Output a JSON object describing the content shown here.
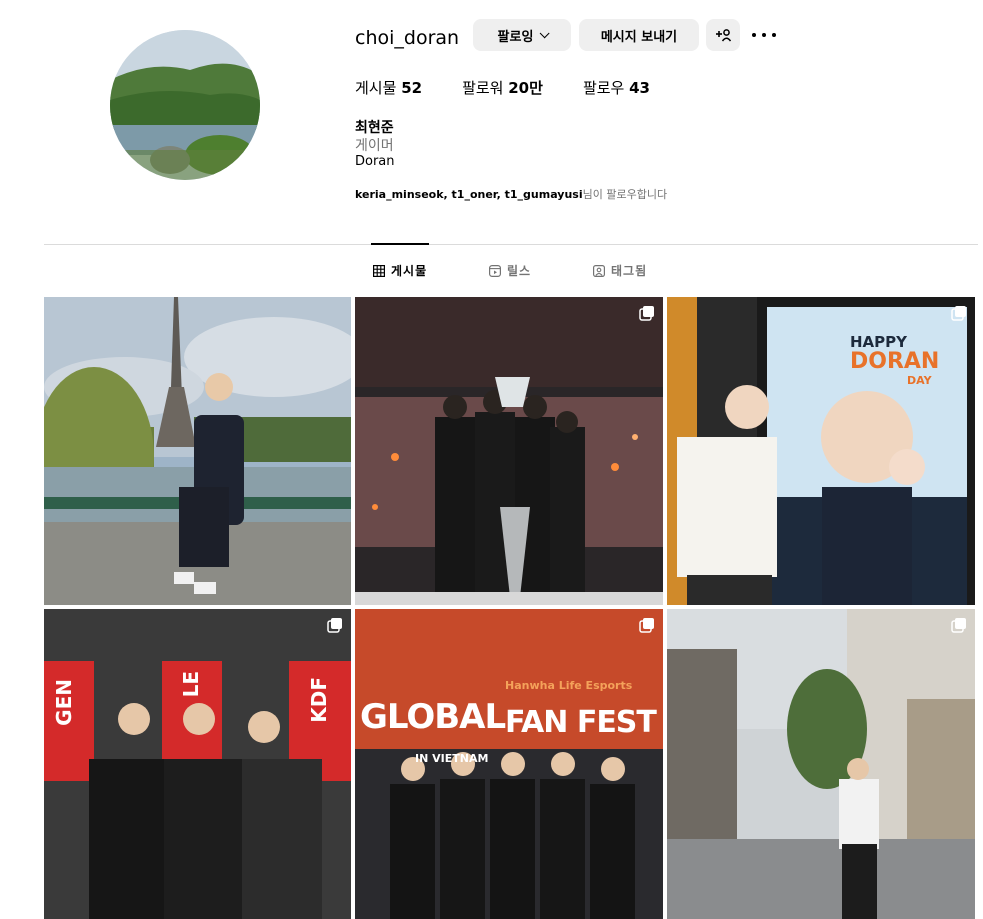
{
  "profile": {
    "username": "choi_doran",
    "follow_button": "팔로잉",
    "message_button": "메시지 보내기",
    "add_button": "+&",
    "stats": {
      "posts_label": "게시물",
      "posts_value": "52",
      "followers_label": "팔로워",
      "followers_value": "20만",
      "following_label": "팔로우",
      "following_value": "43"
    },
    "real_name": "최현준",
    "category": "게이머",
    "bio": "Doran",
    "followed_by_users": "keria_minseok, t1_oner, t1_gumayusi",
    "followed_by_suffix": "님이 팔로우합니다"
  },
  "tabs": [
    {
      "label": "게시물",
      "icon": "grid-icon",
      "active": true
    },
    {
      "label": "릴스",
      "icon": "reels-icon",
      "active": false
    },
    {
      "label": "태그됨",
      "icon": "tagged-icon",
      "active": false
    }
  ],
  "posts": [
    {
      "scene": "eiffel-tower-photo",
      "multi": false
    },
    {
      "scene": "trophy-ceremony-photo",
      "multi": true
    },
    {
      "scene": "happy-doran-day-cafe-photo",
      "multi": true,
      "sign_lines": [
        "HAPPY",
        "DORAN",
        "DAY"
      ]
    },
    {
      "scene": "event-group-photo",
      "multi": true,
      "panel_texts": [
        "GEN",
        "LE",
        "KDF"
      ]
    },
    {
      "scene": "fan-fest-stage-photo",
      "multi": true,
      "banner_small": "Hanwha Life Esports",
      "banner_big_1": "GLOBAL",
      "banner_big_2": "FAN FEST",
      "banner_sub": "IN VIETNAM"
    },
    {
      "scene": "street-photo",
      "multi": true
    }
  ],
  "colors": {
    "button_bg": "#efefef",
    "secondary_text": "#737373",
    "divider": "#dbdbdb"
  }
}
